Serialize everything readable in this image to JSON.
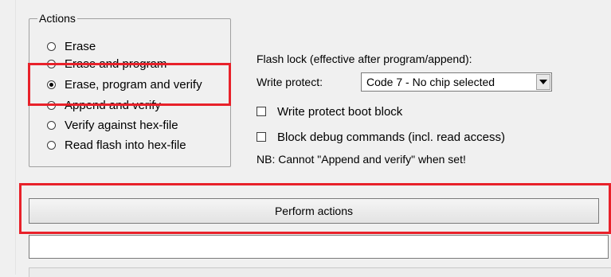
{
  "actions": {
    "title": "Actions",
    "options": [
      {
        "label": "Erase",
        "checked": false
      },
      {
        "label": "Erase and program",
        "checked": false
      },
      {
        "label": "Erase, program and verify",
        "checked": true
      },
      {
        "label": "Append and verify",
        "checked": false
      },
      {
        "label": "Verify against hex-file",
        "checked": false
      },
      {
        "label": "Read flash into hex-file",
        "checked": false
      }
    ]
  },
  "flash_lock": {
    "heading": "Flash lock (effective after program/append):",
    "write_protect_label": "Write protect:",
    "write_protect_value": "Code 7 - No chip selected",
    "write_protect_boot_block": "Write protect boot block",
    "block_debug": "Block debug commands (incl. read access)",
    "note": "NB: Cannot \"Append and verify\" when set!"
  },
  "perform_button": "Perform actions",
  "status_value": "",
  "highlight_color": "#e8212a"
}
